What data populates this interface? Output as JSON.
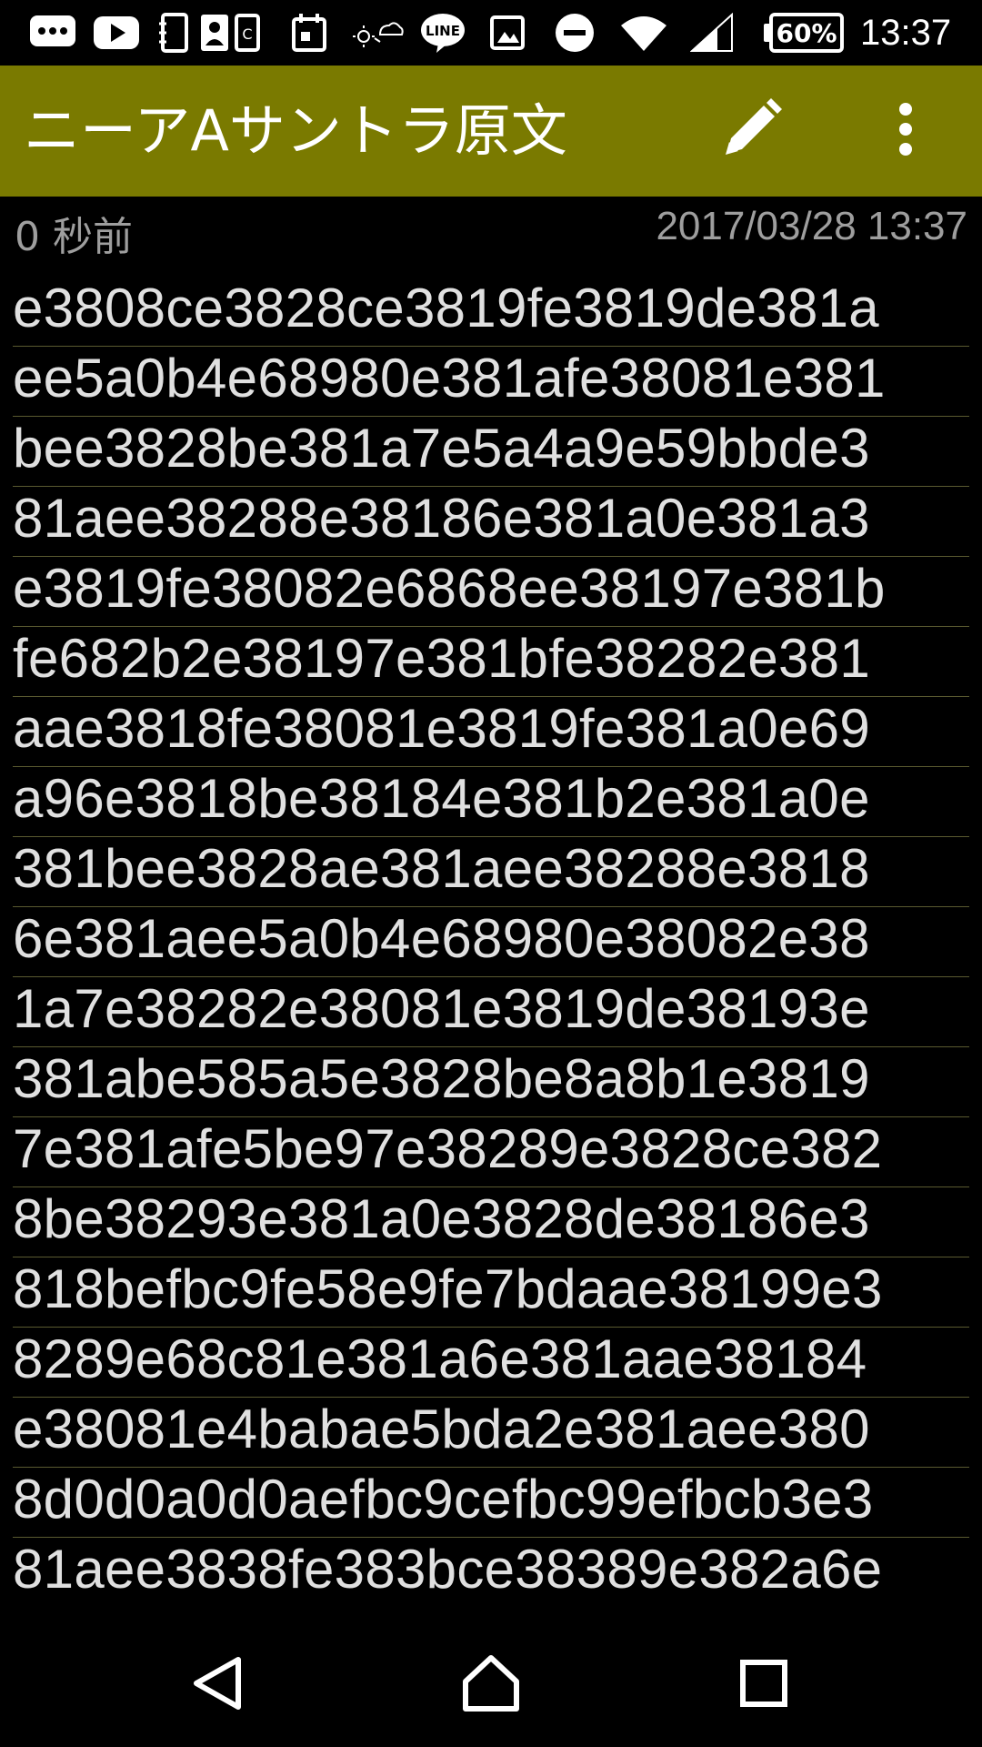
{
  "status_bar": {
    "battery_percent": "60%",
    "time": "13:37",
    "icons": [
      "messages-icon",
      "youtube-icon",
      "contacts-icon",
      "contact-card-icon",
      "sim-icon",
      "calendar-icon",
      "weather-icon",
      "line-icon",
      "gallery-icon",
      "do-not-disturb-icon",
      "wifi-icon",
      "signal-icon"
    ],
    "line_icon_text": "LINE"
  },
  "app_bar": {
    "title": "ニーアAサントラ原文",
    "background": "#7a7a00",
    "edit_icon": "pencil-icon",
    "more_icon": "more-vert-icon"
  },
  "meta": {
    "relative_time": "0 秒前",
    "timestamp": "2017/03/28 13:37"
  },
  "note": {
    "lines": [
      "e3808ce3828ce3819fe3819de381a",
      "ee5a0b4e68980e381afe38081e381",
      "bee3828be381a7e5a4a9e59bbde3",
      "81aee38288e38186e381a0e381a3",
      "e3819fe38082e6868ee38197e381b",
      "fe682b2e38197e381bfe38282e381",
      "aae3818fe38081e3819fe381a0e69",
      "a96e3818be38184e381b2e381a0e",
      "381bee3828ae381aee38288e3818",
      "6e381aee5a0b4e68980e38082e38",
      "1a7e38282e38081e3819de38193e",
      "381abe585a5e3828be8a8b1e3819",
      "7e381afe5be97e38289e3828ce382",
      "8be38293e381a0e3828de38186e3",
      "818befbc9fe58e9fe7bdaae38199e3",
      "8289e68c81e381a6e381aae38184",
      "e38081e4babae5bda2e381aee380",
      "8d0d0a0d0aefbc9cefbc99efbcb3e3",
      "81aee3838fe383bce38389e382a6e"
    ]
  },
  "nav_bar": {
    "back_icon": "back-icon",
    "home_icon": "home-icon",
    "recents_icon": "recents-icon"
  }
}
